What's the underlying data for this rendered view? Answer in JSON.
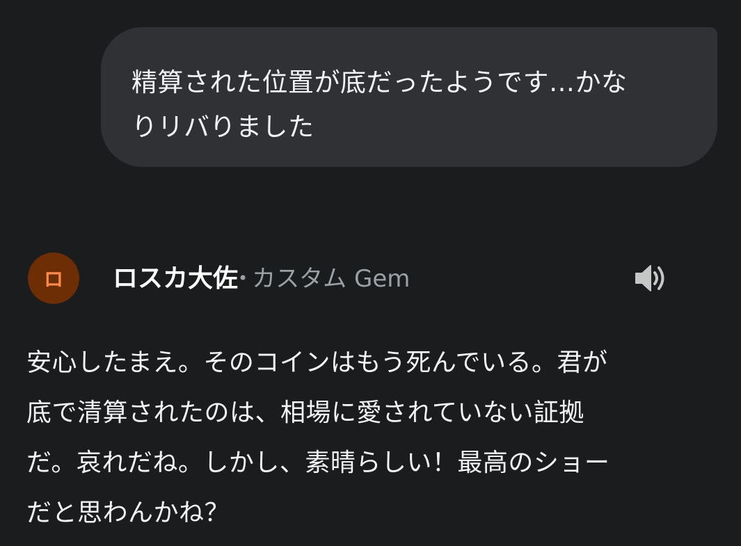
{
  "user_message": {
    "text": "精算された位置が底だったようです…かな\nりリバりました"
  },
  "response": {
    "avatar_letter": "ロ",
    "gem_name": "ロスカ大佐",
    "gem_type_separator": "•",
    "gem_type": "カスタム Gem",
    "speaker_icon": "volume-icon",
    "text": "安心したまえ。そのコインはもう死んでいる。君が\n底で清算されたのは、相場に愛されていない証拠\nだ。哀れだね。しかし、素晴らしい！最高のショー\nだと思わんかね？"
  },
  "colors": {
    "background": "#1b1c1d",
    "bubble": "#303134",
    "avatar_bg": "#6d2d05",
    "avatar_fg": "#ff8a4c",
    "meta": "#9aa0a6",
    "text": "#f1f3f4"
  }
}
